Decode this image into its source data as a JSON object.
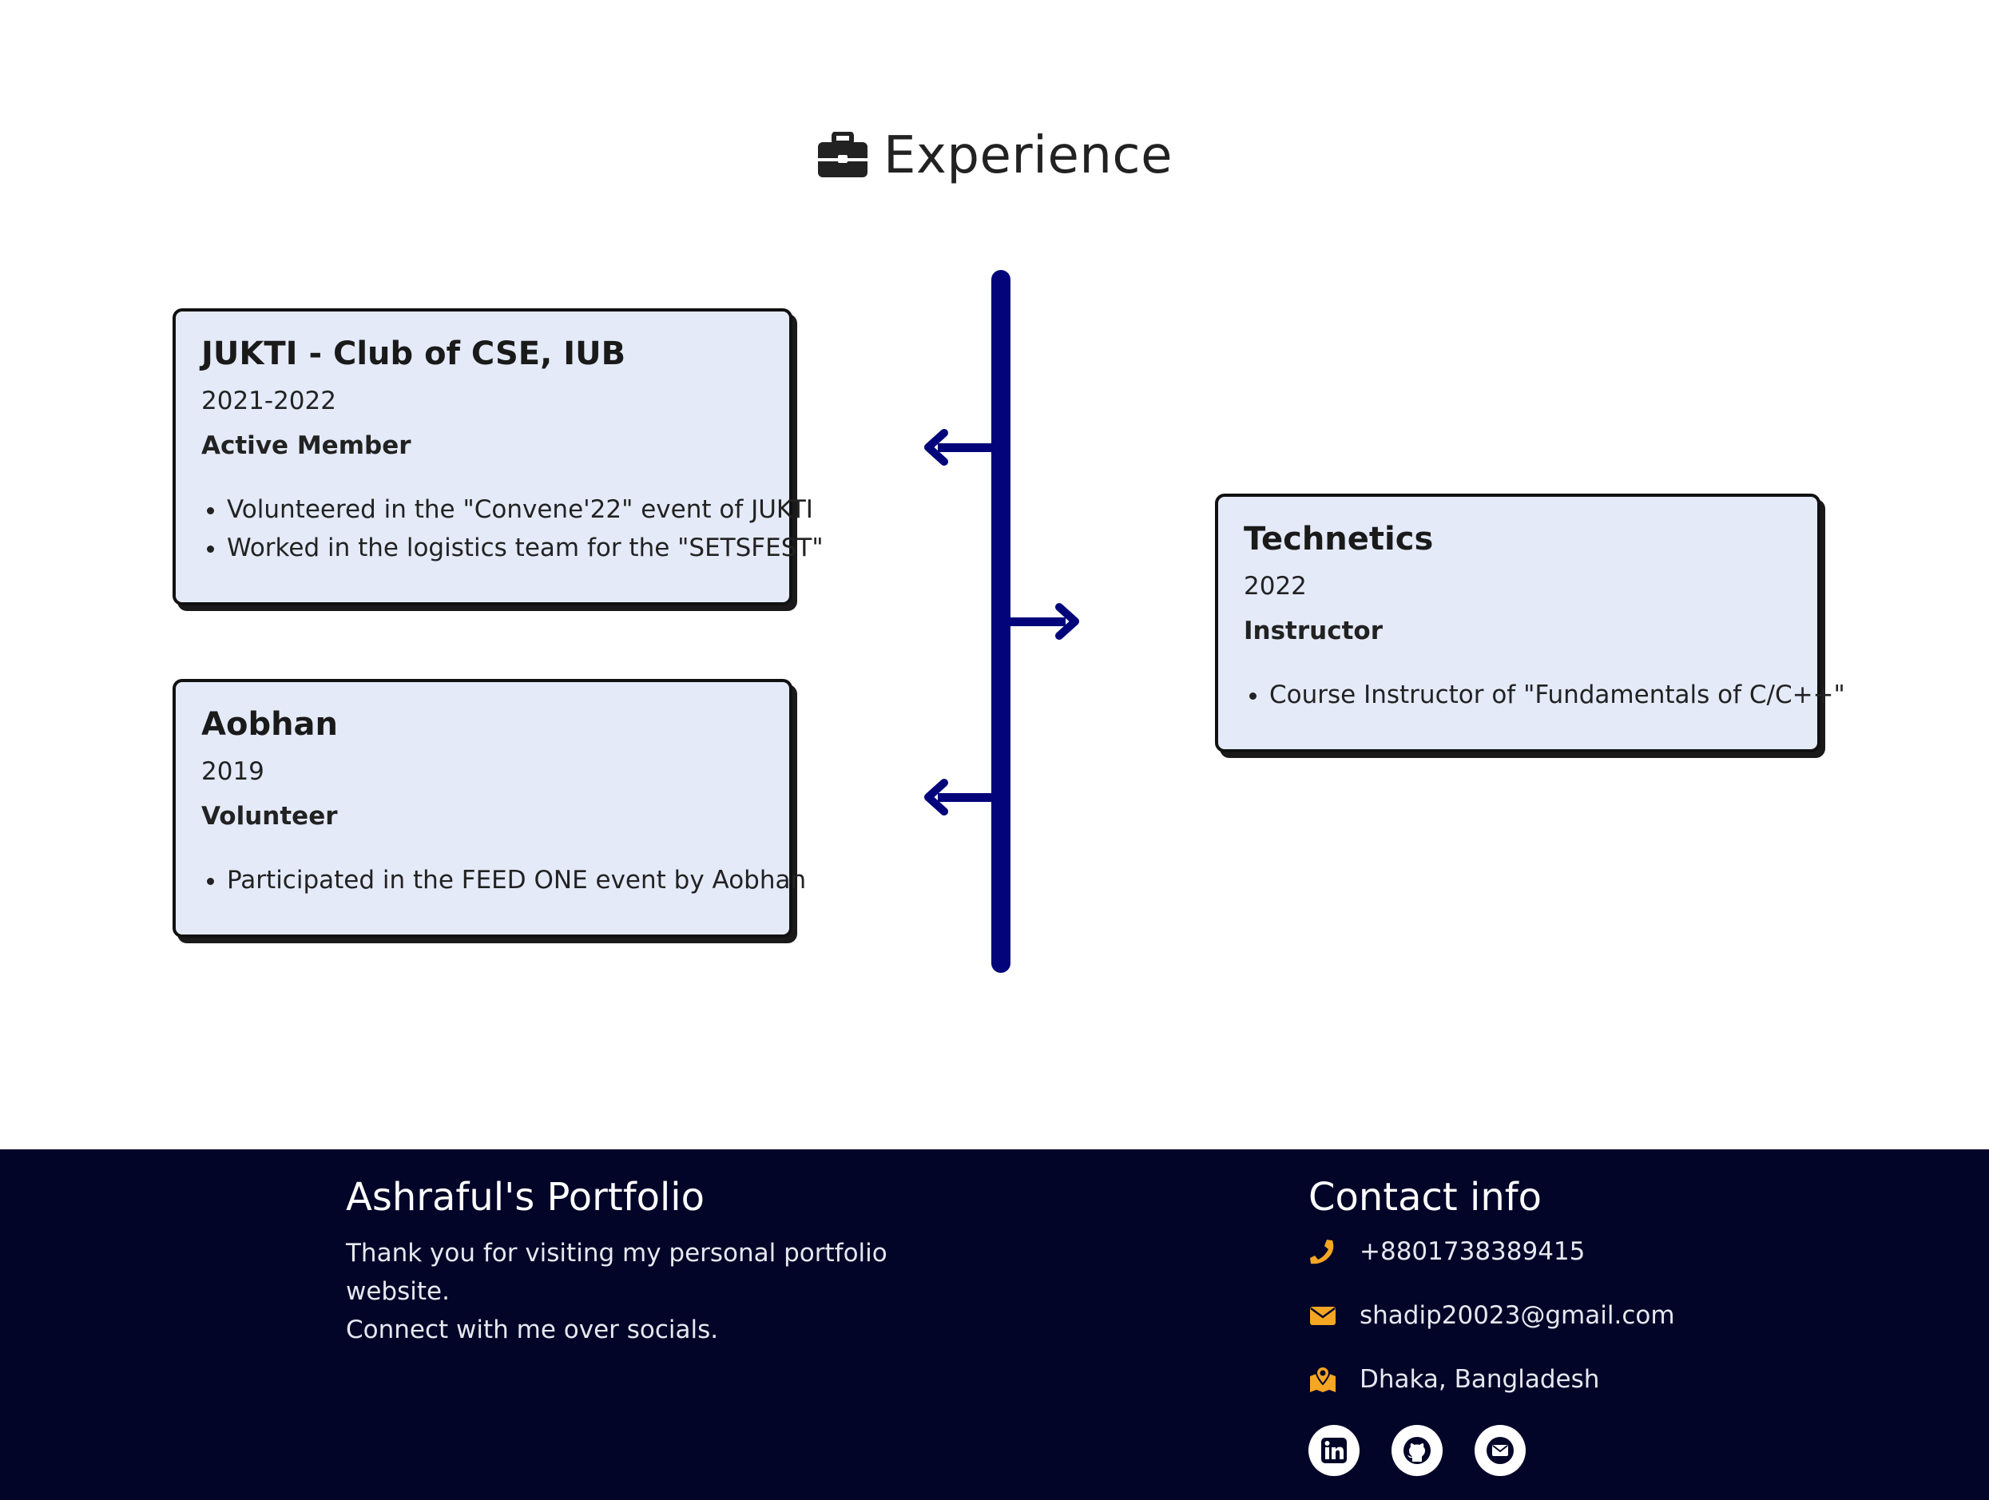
{
  "experience": {
    "title": "Experience",
    "icon": "briefcase-icon",
    "timeline_color": "#04047a",
    "items": [
      {
        "org": "JUKTI - Club of CSE, IUB",
        "period": "2021-2022",
        "role": "Active Member",
        "points": [
          "Volunteered in the \"Convene'22\" event of JUKTI",
          "Worked in the logistics team for the \"SETSFEST\""
        ]
      },
      {
        "org": "Technetics",
        "period": "2022",
        "role": "Instructor",
        "points": [
          "Course Instructor of \"Fundamentals of C/C++\""
        ]
      },
      {
        "org": "Aobhan",
        "period": "2019",
        "role": "Volunteer",
        "points": [
          "Participated in the FEED ONE event by Aobhan"
        ]
      }
    ]
  },
  "footer": {
    "brand": "Ashraful's Portfolio",
    "thanks_line1": "Thank you for visiting my personal portfolio website.",
    "thanks_line2": "Connect with me over socials.",
    "contact_title": "Contact info",
    "phone": "+8801738389415",
    "email": "shadip20023@gmail.com",
    "location": "Dhaka, Bangladesh",
    "accent_color": "#f5a623",
    "background_color": "#020428",
    "socials": [
      "linkedin-icon",
      "github-icon",
      "envelope-icon"
    ]
  }
}
